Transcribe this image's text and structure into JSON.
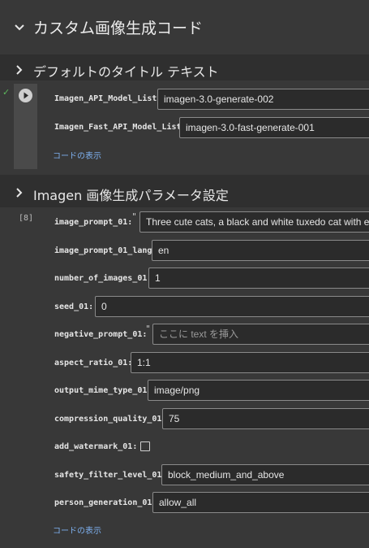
{
  "main_section": {
    "title": "カスタム画像生成コード"
  },
  "default_section": {
    "title": "デフォルトのタイトル テキスト"
  },
  "cell1": {
    "run_status": "✓",
    "fields": [
      {
        "label": "Imagen_API_Model_List:",
        "value": "imagen-3.0-generate-002"
      },
      {
        "label": "Imagen_Fast_API_Model_List:",
        "value": "imagen-3.0-fast-generate-001"
      }
    ],
    "show_code": "コードの表示"
  },
  "imagen_section": {
    "title": "Imagen 画像生成パラメータ設定"
  },
  "cell2": {
    "exec_count": "[8]",
    "fields": [
      {
        "label": "image_prompt_01:",
        "quote": "\"",
        "value": "Three cute cats, a black and white tuxedo cat with e"
      },
      {
        "label": "image_prompt_01_lang:",
        "value": "en"
      },
      {
        "label": "number_of_images_01:",
        "value": "1"
      },
      {
        "label": "seed_01:",
        "value": "0"
      },
      {
        "label": "negative_prompt_01:",
        "quote": "\"",
        "placeholder": "ここに text を挿入"
      },
      {
        "label": "aspect_ratio_01:",
        "value": "1:1"
      },
      {
        "label": "output_mime_type_01:",
        "value": "image/png"
      },
      {
        "label": "compression_quality_01:",
        "value": "75"
      },
      {
        "label": "add_watermark_01:",
        "checked": false
      },
      {
        "label": "safety_filter_level_01:",
        "value": "block_medium_and_above"
      },
      {
        "label": "person_generation_01:",
        "value": "allow_all"
      }
    ],
    "show_code": "コードの表示"
  },
  "colors": {
    "background": "#383838",
    "band": "#2f2f2f",
    "link": "#7eb1f0",
    "field_border": "#8a8a8a"
  }
}
